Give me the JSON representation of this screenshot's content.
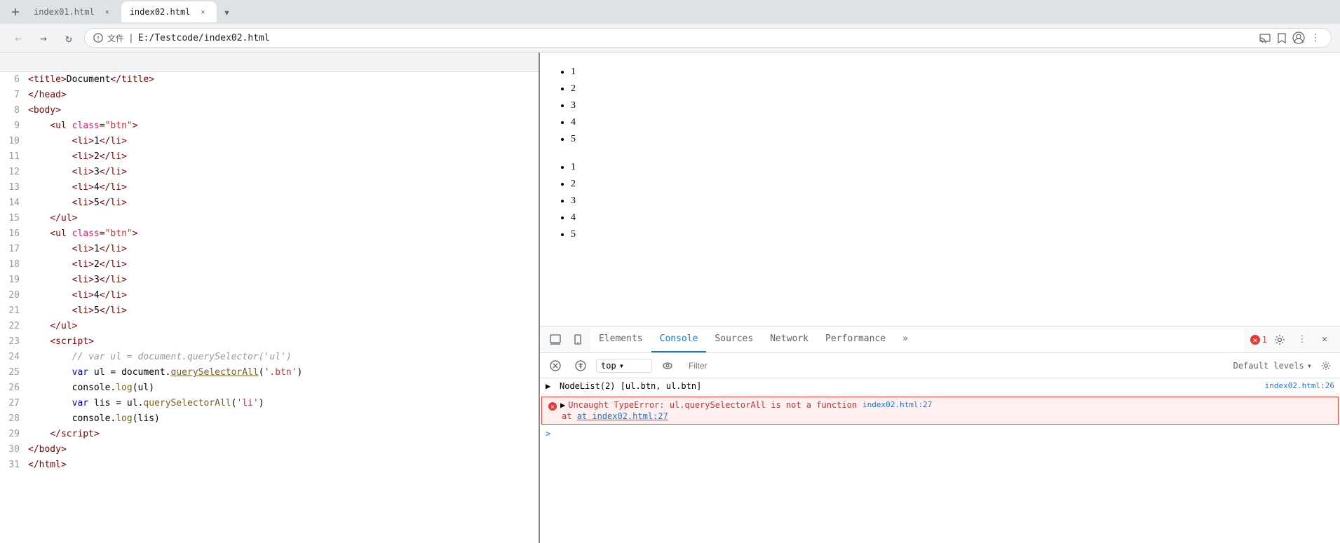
{
  "browser": {
    "tabs": [
      {
        "id": "tab1",
        "label": "index01.html",
        "active": false
      },
      {
        "id": "tab2",
        "label": "index02.html",
        "active": true
      }
    ],
    "address": "E:/Testcode/index02.html",
    "address_prefix": "文件",
    "nav": {
      "back": "←",
      "forward": "→",
      "refresh": "↻"
    }
  },
  "code": {
    "lines": [
      {
        "num": "6",
        "html": "<span class='c-tag'>&lt;title&gt;</span><span>Document</span><span class='c-tag'>&lt;/title&gt;</span>"
      },
      {
        "num": "7",
        "html": "<span class='c-tag'>&lt;/head&gt;</span>"
      },
      {
        "num": "8",
        "html": "<span class='c-tag'>&lt;body&gt;</span>"
      },
      {
        "num": "9",
        "html": "<span style='margin-left:24px'></span><span class='c-tag'>&lt;ul </span><span class='c-attr'>class</span><span class='c-tag'>=</span><span class='c-string'>\"btn\"</span><span class='c-tag'>&gt;</span>"
      },
      {
        "num": "10",
        "html": "<span style='margin-left:48px'></span><span class='c-tag'>&lt;li&gt;</span><span>1</span><span class='c-tag'>&lt;/li&gt;</span>"
      },
      {
        "num": "11",
        "html": "<span style='margin-left:48px'></span><span class='c-tag'>&lt;li&gt;</span><span>2</span><span class='c-tag'>&lt;/li&gt;</span>"
      },
      {
        "num": "12",
        "html": "<span style='margin-left:48px'></span><span class='c-tag'>&lt;li&gt;</span><span>3</span><span class='c-tag'>&lt;/li&gt;</span>"
      },
      {
        "num": "13",
        "html": "<span style='margin-left:48px'></span><span class='c-tag'>&lt;li&gt;</span><span>4</span><span class='c-tag'>&lt;/li&gt;</span>"
      },
      {
        "num": "14",
        "html": "<span style='margin-left:48px'></span><span class='c-tag'>&lt;li&gt;</span><span>5</span><span class='c-tag'>&lt;/li&gt;</span>"
      },
      {
        "num": "15",
        "html": "<span style='margin-left:24px'></span><span class='c-tag'>&lt;/ul&gt;</span>"
      },
      {
        "num": "16",
        "html": "<span style='margin-left:24px'></span><span class='c-tag'>&lt;ul </span><span class='c-attr'>class</span><span class='c-tag'>=</span><span class='c-string'>\"btn\"</span><span class='c-tag'>&gt;</span>"
      },
      {
        "num": "17",
        "html": "<span style='margin-left:48px'></span><span class='c-tag'>&lt;li&gt;</span><span>1</span><span class='c-tag'>&lt;/li&gt;</span>"
      },
      {
        "num": "18",
        "html": "<span style='margin-left:48px'></span><span class='c-tag'>&lt;li&gt;</span><span>2</span><span class='c-tag'>&lt;/li&gt;</span>"
      },
      {
        "num": "19",
        "html": "<span style='margin-left:48px'></span><span class='c-tag'>&lt;li&gt;</span><span>3</span><span class='c-tag'>&lt;/li&gt;</span>"
      },
      {
        "num": "20",
        "html": "<span style='margin-left:48px'></span><span class='c-tag'>&lt;li&gt;</span><span>4</span><span class='c-tag'>&lt;/li&gt;</span>"
      },
      {
        "num": "21",
        "html": "<span style='margin-left:48px'></span><span class='c-tag'>&lt;li&gt;</span><span>5</span><span class='c-tag'>&lt;/li&gt;</span>"
      },
      {
        "num": "22",
        "html": "<span style='margin-left:24px'></span><span class='c-tag'>&lt;/ul&gt;</span>"
      },
      {
        "num": "23",
        "html": "<span style='margin-left:24px'></span><span class='c-tag'>&lt;script&gt;</span>"
      },
      {
        "num": "24",
        "html": "<span style='margin-left:48px'></span><span class='c-comment'>// var ul = document.querySelector('ul')</span>"
      },
      {
        "num": "25",
        "html": "<span style='margin-left:48px'></span><span class='c-keyword'>var</span><span> ul = document.</span><span class='c-method underline'>querySelectorAll</span><span class='c-string'>('.btn'</span><span>)</span>"
      },
      {
        "num": "26",
        "html": "<span style='margin-left:48px'></span><span>console.</span><span class='c-method'>log</span><span>(ul)</span>"
      },
      {
        "num": "27",
        "html": "<span style='margin-left:48px'></span><span class='c-keyword'>var</span><span> lis = ul.</span><span class='c-method'>querySelectorAll</span><span class='c-string'>('li'</span><span>)</span>"
      },
      {
        "num": "28",
        "html": "<span style='margin-left:48px'></span><span>console.</span><span class='c-method'>log</span><span>(lis)</span>"
      },
      {
        "num": "29",
        "html": "<span style='margin-left:24px'></span><span class='c-tag'>&lt;/script&gt;</span>"
      },
      {
        "num": "30",
        "html": "<span class='c-tag'>&lt;/body&gt;</span>"
      },
      {
        "num": "31",
        "html": "<span class='c-tag'>&lt;/html&gt;</span>"
      }
    ]
  },
  "page": {
    "list1": [
      "1",
      "2",
      "3",
      "4",
      "5"
    ],
    "list2": [
      "1",
      "2",
      "3",
      "4",
      "5"
    ]
  },
  "devtools": {
    "tabs": [
      "Elements",
      "Console",
      "Sources",
      "Network",
      "Performance"
    ],
    "active_tab": "Console",
    "more_label": "»",
    "error_count": "1",
    "console_bar": {
      "context": "top",
      "filter_placeholder": "Filter",
      "levels": "Default levels"
    },
    "console": {
      "nodelist_row": {
        "arrow": "▶",
        "text": "NodeList(2) [ul.btn, ul.btn]",
        "src": "index02.html:26"
      },
      "error_row": {
        "arrow": "▶",
        "text": "Uncaught TypeError: ul.querySelectorAll is not a function",
        "indent_text": "at index02.html:27",
        "src": "index02.html:27"
      },
      "prompt": ">"
    }
  }
}
